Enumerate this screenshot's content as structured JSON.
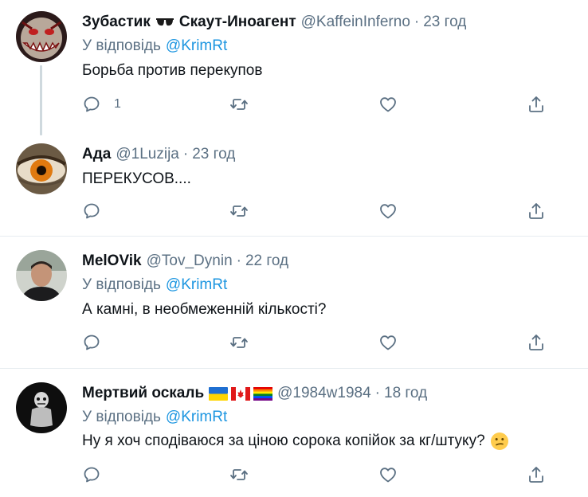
{
  "tweets": [
    {
      "name": "Зубастик",
      "name_suffix": "Скаут-Иноагент",
      "handle": "@KaffeinInferno",
      "dot": "·",
      "time": "23 год",
      "reply_label": "У відповідь",
      "reply_mention": "@KrimRt",
      "text": "Борьба против перекупов",
      "reply_count": "1"
    },
    {
      "name": "Ада",
      "handle": "@1Luzija",
      "dot": "·",
      "time": "23 год",
      "text": "ПЕРЕКУСОВ...."
    },
    {
      "name": "MelOVik",
      "handle": "@Tov_Dynin",
      "dot": "·",
      "time": "22 год",
      "reply_label": "У відповідь",
      "reply_mention": "@KrimRt",
      "text": "А камні, в необмеженній кількості?"
    },
    {
      "name": "Мертвий оскаль",
      "handle": "@1984w1984",
      "dot": "·",
      "time": "18 год",
      "reply_label": "У відповідь",
      "reply_mention": "@KrimRt",
      "text": "Ну я хоч сподіваюся за ціною сорока копійок за кг/штуку?"
    }
  ],
  "colors": {
    "text": "#0f1419",
    "secondary": "#5b7083",
    "link": "#1b95e0",
    "divider": "#e6ecf0",
    "thread_line": "#cfd9de"
  }
}
